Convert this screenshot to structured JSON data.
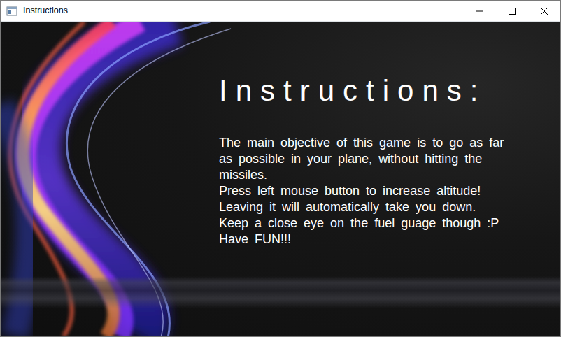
{
  "window": {
    "title": "Instructions"
  },
  "heading": "Instructions:",
  "paragraph": [
    "The main objective of this game is to go as far",
    "as possible in your plane, without hitting the",
    "missiles.",
    "Press left mouse button to increase altitude!",
    "Leaving it will automatically take you down.",
    "Keep a close eye on the fuel guage though :P",
    "Have FUN!!!"
  ]
}
